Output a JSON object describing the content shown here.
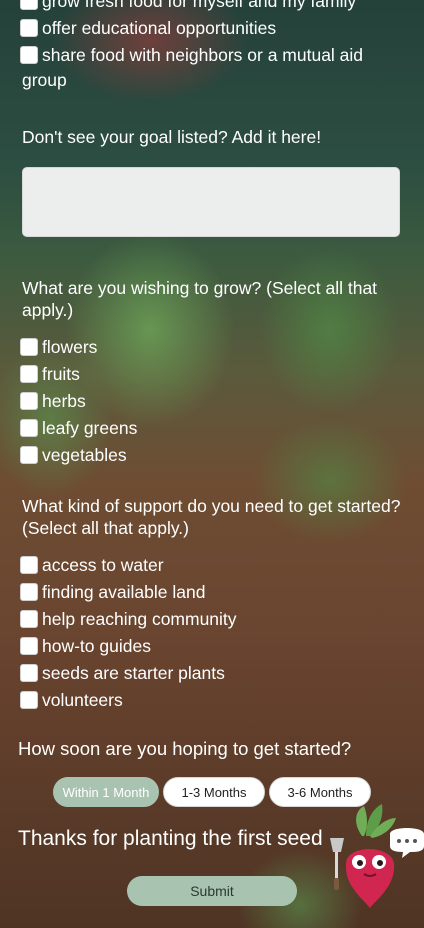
{
  "goals": {
    "items": [
      {
        "label": "grow fresh food for myself and my family"
      },
      {
        "label": "offer educational opportunities"
      },
      {
        "label": "share food with neighbors or a mutual aid"
      }
    ],
    "wrap": "group"
  },
  "custom_goal": {
    "question": "Don't see your goal listed? Add it here!",
    "value": ""
  },
  "grow": {
    "question": "What are you wishing to grow? (Select all that apply.)",
    "items": [
      {
        "label": "flowers"
      },
      {
        "label": "fruits"
      },
      {
        "label": "herbs"
      },
      {
        "label": "leafy greens"
      },
      {
        "label": "vegetables"
      }
    ]
  },
  "support": {
    "question": "What kind of support do you need to get started? (Select all that apply.)",
    "items": [
      {
        "label": "access to water"
      },
      {
        "label": "finding available land"
      },
      {
        "label": "help reaching community"
      },
      {
        "label": "how-to guides"
      },
      {
        "label": "seeds are starter plants"
      },
      {
        "label": "volunteers"
      }
    ]
  },
  "timing": {
    "question": "How soon are you hoping to get started?",
    "options": [
      {
        "label": "Within 1 Month",
        "selected": true
      },
      {
        "label": "1-3 Months",
        "selected": false
      },
      {
        "label": "3-6 Months",
        "selected": false
      }
    ]
  },
  "thanks": "Thanks for planting the first seed",
  "submit_label": "Submit",
  "chat_icon": "chat-bubble-icon",
  "colors": {
    "accent": "#a8c4b0",
    "beet": "#d1264f",
    "leaf": "#6fae56"
  }
}
